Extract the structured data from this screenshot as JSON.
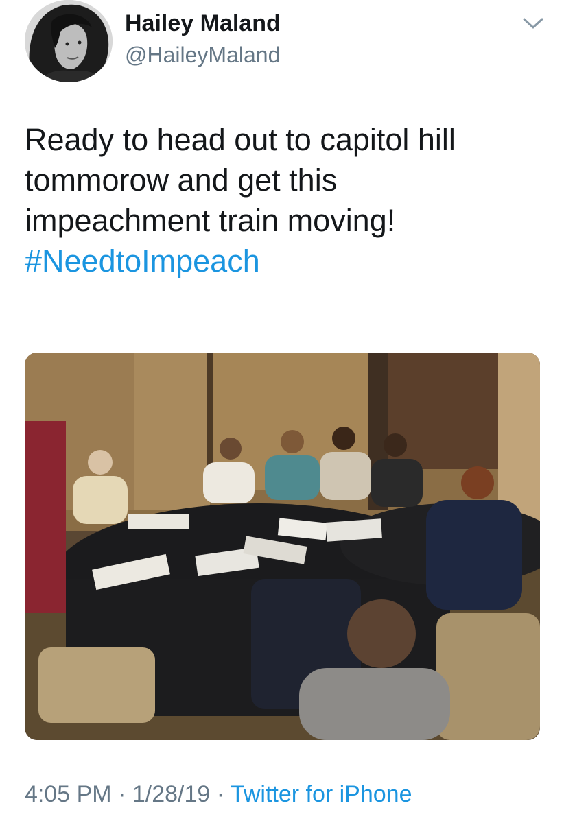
{
  "author": {
    "name": "Hailey Maland",
    "handle": "@HaileyMaland",
    "avatar_icon": "profile-photo"
  },
  "header": {
    "more_icon": "chevron-down-icon",
    "icon_color": "#8899a6"
  },
  "tweet": {
    "lines": [
      "Ready to head out to capitol hill",
      "tommorow and get this",
      "impeachment train moving!"
    ],
    "hashtag": "#NeedtoImpeach"
  },
  "media": {
    "kind": "photo",
    "subject": "people seated at round tables with papers in a conference room"
  },
  "meta": {
    "time": "4:05 PM",
    "separator": "·",
    "date": "1/28/19",
    "source": "Twitter for iPhone"
  },
  "colors": {
    "text": "#14171a",
    "secondary": "#657786",
    "link": "#1b95e0"
  }
}
